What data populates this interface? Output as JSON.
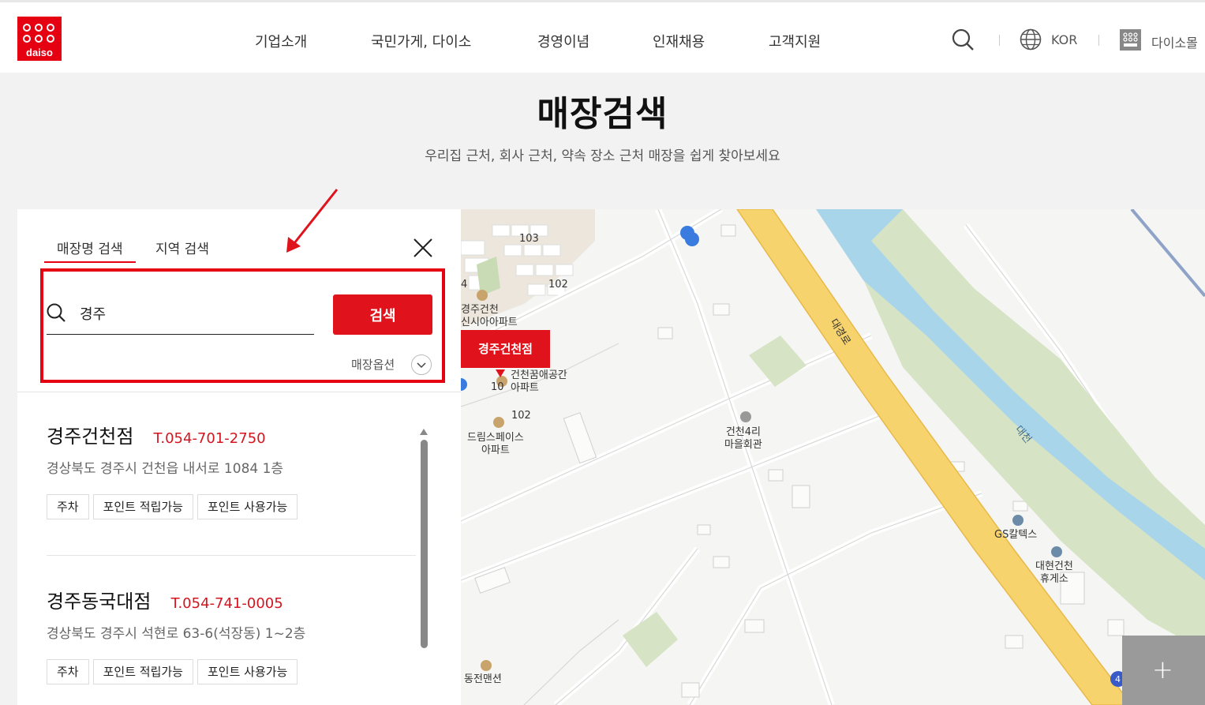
{
  "brand": {
    "logo_text": "daiso",
    "accent": "#e50012"
  },
  "nav": {
    "items": [
      "기업소개",
      "국민가게, 다이소",
      "경영이념",
      "인재채용",
      "고객지원"
    ]
  },
  "utility": {
    "lang": "KOR",
    "mall": "다이소몰"
  },
  "page": {
    "title": "매장검색",
    "subtitle": "우리집 근처, 회사 근처, 약속 장소 근처 매장을 쉽게 찾아보세요"
  },
  "panel": {
    "tabs": [
      {
        "label": "매장명 검색",
        "active": true
      },
      {
        "label": "지역 검색",
        "active": false
      }
    ],
    "search": {
      "value": "경주",
      "button": "검색",
      "option_label": "매장옵션"
    },
    "stores": [
      {
        "name": "경주건천점",
        "phone": "T.054-701-2750",
        "address": "경상북도 경주시 건천읍 내서로 1084 1층",
        "tags": [
          "주차",
          "포인트 적립가능",
          "포인트 사용가능"
        ]
      },
      {
        "name": "경주동국대점",
        "phone": "T.054-741-0005",
        "address": "경상북도 경주시 석현로 63-6(석장동) 1~2층",
        "tags": [
          "주차",
          "포인트 적립가능",
          "포인트 사용가능"
        ]
      }
    ]
  },
  "map": {
    "marker_label": "경주건천점",
    "labels": {
      "apt_a": "경주건천\n신시아아파트",
      "apt_b": "건천꿈애공간\n아파트",
      "apt_c": "드림스페이스\n아파트",
      "hall": "건천4리\n마을회관",
      "gas": "GS칼텍스",
      "rest": "대현건천\n휴게소",
      "mansion": "동전맨션",
      "road": "대경로",
      "river": "대천",
      "bldg_103": "103",
      "bldg_102": "102",
      "bldg_102b": "102",
      "bldg_4": "4",
      "bldg_10x": "10",
      "road_num": "4"
    },
    "zoom_in": "+"
  }
}
